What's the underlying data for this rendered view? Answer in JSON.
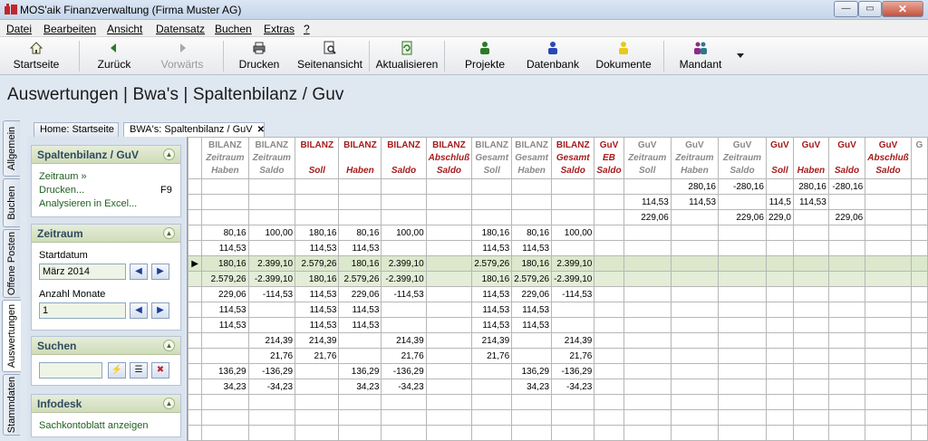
{
  "window": {
    "title": "MOS'aik Finanzverwaltung (Firma Muster AG)",
    "min": "—",
    "max": "▭",
    "close": "✕"
  },
  "menu": [
    "Datei",
    "Bearbeiten",
    "Ansicht",
    "Datensatz",
    "Buchen",
    "Extras",
    "?"
  ],
  "toolbar": {
    "startseite": "Startseite",
    "zurueck": "Zurück",
    "vorwaerts": "Vorwärts",
    "drucken": "Drucken",
    "seitenansicht": "Seitenansicht",
    "aktualisieren": "Aktualisieren",
    "projekte": "Projekte",
    "datenbank": "Datenbank",
    "dokumente": "Dokumente",
    "mandant": "Mandant"
  },
  "heading": "Auswertungen | Bwa's | Spaltenbilanz / Guv",
  "side_tabs": [
    "Allgemein",
    "Buchen",
    "Offene Posten",
    "Auswertungen",
    "Stammdaten"
  ],
  "doc_tabs": {
    "home": "Home: Startseite",
    "active": "BWA's: Spaltenbilanz / GuV"
  },
  "panels": {
    "spalten": {
      "title": "Spaltenbilanz / GuV",
      "link1": "Zeitraum »",
      "link2": "Drucken...",
      "shortcut": "F9",
      "link3": "Analysieren in Excel..."
    },
    "zeitraum": {
      "title": "Zeitraum",
      "startdatum_label": "Startdatum",
      "startdatum_value": "März 2014",
      "monate_label": "Anzahl Monate",
      "monate_value": "1"
    },
    "suchen": {
      "title": "Suchen",
      "value": ""
    },
    "infodesk": {
      "title": "Infodesk",
      "link": "Sachkontoblatt anzeigen"
    }
  },
  "grid": {
    "columns": [
      {
        "l1": "BILANZ",
        "l2": "Zeitraum",
        "l3": "Haben",
        "c": "gray"
      },
      {
        "l1": "BILANZ",
        "l2": "Zeitraum",
        "l3": "Saldo",
        "c": "gray"
      },
      {
        "l1": "BILANZ",
        "l2": "",
        "l3": "Soll",
        "c": "red"
      },
      {
        "l1": "BILANZ",
        "l2": "",
        "l3": "Haben",
        "c": "red"
      },
      {
        "l1": "BILANZ",
        "l2": "",
        "l3": "Saldo",
        "c": "red"
      },
      {
        "l1": "BILANZ",
        "l2": "Abschluß",
        "l3": "Saldo",
        "c": "red"
      },
      {
        "l1": "BILANZ",
        "l2": "Gesamt",
        "l3": "Soll",
        "c": "gray"
      },
      {
        "l1": "BILANZ",
        "l2": "Gesamt",
        "l3": "Haben",
        "c": "gray"
      },
      {
        "l1": "BILANZ",
        "l2": "Gesamt",
        "l3": "Saldo",
        "c": "red"
      },
      {
        "l1": "GuV",
        "l2": "EB",
        "l3": "Saldo",
        "c": "red"
      },
      {
        "l1": "GuV",
        "l2": "Zeitraum",
        "l3": "Soll",
        "c": "gray"
      },
      {
        "l1": "GuV",
        "l2": "Zeitraum",
        "l3": "Haben",
        "c": "gray"
      },
      {
        "l1": "GuV",
        "l2": "Zeitraum",
        "l3": "Saldo",
        "c": "gray"
      },
      {
        "l1": "GuV",
        "l2": "",
        "l3": "Soll",
        "c": "red"
      },
      {
        "l1": "GuV",
        "l2": "",
        "l3": "Haben",
        "c": "red"
      },
      {
        "l1": "GuV",
        "l2": "",
        "l3": "Saldo",
        "c": "red"
      },
      {
        "l1": "GuV",
        "l2": "Abschluß",
        "l3": "Saldo",
        "c": "red"
      },
      {
        "l1": "G",
        "l2": "",
        "l3": "",
        "c": "gray"
      }
    ],
    "rows": [
      [
        "",
        "",
        "",
        "",
        "",
        "",
        "",
        "",
        "",
        "",
        "",
        "280,16",
        "-280,16",
        "",
        "280,16",
        "-280,16",
        "",
        ""
      ],
      [
        "",
        "",
        "",
        "",
        "",
        "",
        "",
        "",
        "",
        "",
        "114,53",
        "114,53",
        "",
        "114,5",
        "114,53",
        "",
        "",
        ""
      ],
      [
        "",
        "",
        "",
        "",
        "",
        "",
        "",
        "",
        "",
        "",
        "229,06",
        "",
        "229,06",
        "229,0",
        "",
        "229,06",
        "",
        ""
      ],
      [
        "80,16",
        "100,00",
        "180,16",
        "80,16",
        "100,00",
        "",
        "180,16",
        "80,16",
        "100,00",
        "",
        "",
        "",
        "",
        "",
        "",
        "",
        "",
        ""
      ],
      [
        "114,53",
        "",
        "114,53",
        "114,53",
        "",
        "",
        "114,53",
        "114,53",
        "",
        "",
        "",
        "",
        "",
        "",
        "",
        "",
        "",
        ""
      ],
      [
        "180,16",
        "2.399,10",
        "2.579,26",
        "180,16",
        "2.399,10",
        "",
        "2.579,26",
        "180,16",
        "2.399,10",
        "",
        "",
        "",
        "",
        "",
        "",
        "",
        "",
        ""
      ],
      [
        "2.579,26",
        "-2.399,10",
        "180,16",
        "2.579,26",
        "-2.399,10",
        "",
        "180,16",
        "2.579,26",
        "-2.399,10",
        "",
        "",
        "",
        "",
        "",
        "",
        "",
        "",
        ""
      ],
      [
        "229,06",
        "-114,53",
        "114,53",
        "229,06",
        "-114,53",
        "",
        "114,53",
        "229,06",
        "-114,53",
        "",
        "",
        "",
        "",
        "",
        "",
        "",
        "",
        ""
      ],
      [
        "114,53",
        "",
        "114,53",
        "114,53",
        "",
        "",
        "114,53",
        "114,53",
        "",
        "",
        "",
        "",
        "",
        "",
        "",
        "",
        "",
        ""
      ],
      [
        "114,53",
        "",
        "114,53",
        "114,53",
        "",
        "",
        "114,53",
        "114,53",
        "",
        "",
        "",
        "",
        "",
        "",
        "",
        "",
        "",
        ""
      ],
      [
        "",
        "214,39",
        "214,39",
        "",
        "214,39",
        "",
        "214,39",
        "",
        "214,39",
        "",
        "",
        "",
        "",
        "",
        "",
        "",
        "",
        ""
      ],
      [
        "",
        "21,76",
        "21,76",
        "",
        "21,76",
        "",
        "21,76",
        "",
        "21,76",
        "",
        "",
        "",
        "",
        "",
        "",
        "",
        "",
        ""
      ],
      [
        "136,29",
        "-136,29",
        "",
        "136,29",
        "-136,29",
        "",
        "",
        "136,29",
        "-136,29",
        "",
        "",
        "",
        "",
        "",
        "",
        "",
        "",
        ""
      ],
      [
        "34,23",
        "-34,23",
        "",
        "34,23",
        "-34,23",
        "",
        "",
        "34,23",
        "-34,23",
        "",
        "",
        "",
        "",
        "",
        "",
        "",
        "",
        ""
      ],
      [
        "",
        "",
        "",
        "",
        "",
        "",
        "",
        "",
        "",
        "",
        "",
        "",
        "",
        "",
        "",
        "",
        "",
        ""
      ],
      [
        "",
        "",
        "",
        "",
        "",
        "",
        "",
        "",
        "",
        "",
        "",
        "",
        "",
        "",
        "",
        "",
        "",
        ""
      ],
      [
        "",
        "",
        "",
        "",
        "",
        "",
        "",
        "",
        "",
        "",
        "",
        "",
        "",
        "",
        "",
        "",
        "",
        ""
      ]
    ],
    "current_row_marker": "▶"
  }
}
